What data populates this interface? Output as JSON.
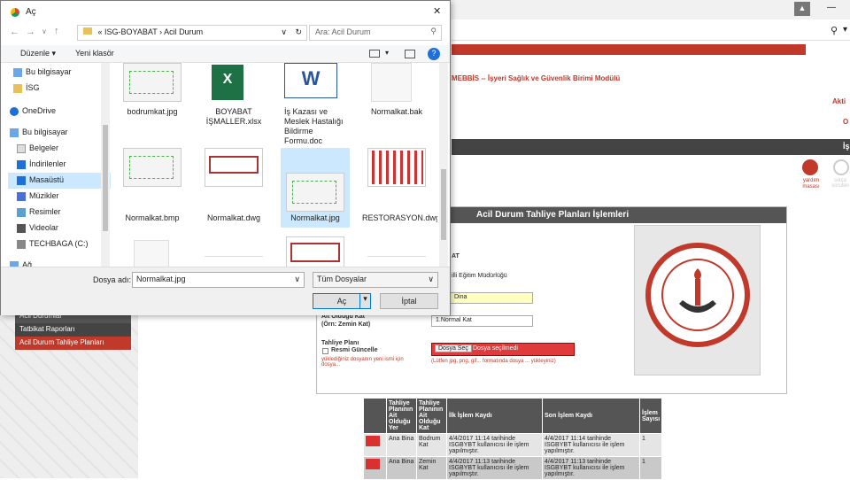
{
  "browser": {
    "avatar_glyph": "▲",
    "minimize": "—",
    "search_glyph": "⚲",
    "dropdown": "▾"
  },
  "site": {
    "header": "MEBBİS -- İşyeri Sağlık ve Güvenlik Birimi Modülü",
    "right_a": "Akti",
    "right_b": "O",
    "right_c": "İş",
    "help_user": "yardım masası",
    "help_q": "sıkça sorulan"
  },
  "left_menu": [
    "Acil Durumlar",
    "Tatbikat Raporları",
    "Acil Durum Tahliye Planları"
  ],
  "panel": {
    "title": "Acil Durum Tahliye Planları İşlemleri",
    "frag_at": "AT",
    "frag_mudurluk": "illi Eğitim Müdürlüğü",
    "bina_value": "Dina",
    "kat_label": "Alt Olduğu Kat",
    "kat_label2": "(Örn: Zemin Kat)",
    "kat_value": "1.Normal Kat",
    "plan_label": "Tahliye Planı",
    "resmi_label": "Resmi Güncelle",
    "warn_note": "yüklediğiniz dosyanın yeni ismi için dosya...",
    "file_btn": "Dosya Seç",
    "file_none": "Dosya seçilmedi",
    "file_hint": "(Lütfen jpg, png, gif... formatında dosya ... yükleyiniz)"
  },
  "table": {
    "headers": [
      "Tahliye Planının Ait Olduğu Yer",
      "Tahliye Planının Ait Olduğu Kat",
      "İlk İşlem Kaydı",
      "Son İşlem Kaydı",
      "İşlem Sayısı"
    ],
    "rows": [
      [
        "Ana Bina",
        "Bodrum Kat",
        "4/4/2017 11:14 tarihinde ISGBYBT kullanıcısı ile işlem yapılmıştır.",
        "4/4/2017 11:14 tarihinde ISGBYBT kullanıcısı ile işlem yapılmıştır.",
        "1"
      ],
      [
        "Ana Bina",
        "Zemin Kat",
        "4/4/2017 11:13 tarihinde ISGBYBT kullanıcısı ile işlem yapılmıştır.",
        "4/4/2017 11:13 tarihinde ISGBYBT kullanıcısı ile işlem yapılmıştır.",
        "1"
      ]
    ]
  },
  "dialog": {
    "title": "Aç",
    "close": "✕",
    "path_prefix": "«",
    "path_1": "ISG-BOYABAT",
    "path_sep": "›",
    "path_2": "Acil Durum",
    "search_placeholder": "Ara: Acil Durum",
    "organize": "Düzenle ▾",
    "new_folder": "Yeni klasör",
    "nav_items": [
      "Bu bilgisayar",
      "İSG",
      "OneDrive",
      "Bu bilgisayar",
      "Belgeler",
      "İndirilenler",
      "Masaüstü",
      "Müzikler",
      "Resimler",
      "Videolar",
      "TECHBAGA (C:)",
      "Ağ"
    ],
    "files": [
      "bodrumkat.jpg",
      "BOYABAT İŞMALLER.xlsx",
      "İş Kazası ve Meslek Hastalığı Bildirme Formu.doc",
      "Normalkat.bak",
      "Normalkat.bmp",
      "Normalkat.dwg",
      "Normalkat.jpg",
      "RESTORASYON.dwg",
      "",
      "",
      "",
      ""
    ],
    "filename_label": "Dosya adı:",
    "filename_value": "Normalkat.jpg",
    "filter_value": "Tüm Dosyalar",
    "open_btn": "Aç",
    "cancel_btn": "İptal"
  },
  "colors": {
    "accent": "#c0392b",
    "selection": "#cce8ff",
    "dialog_bg": "#ffffff"
  }
}
